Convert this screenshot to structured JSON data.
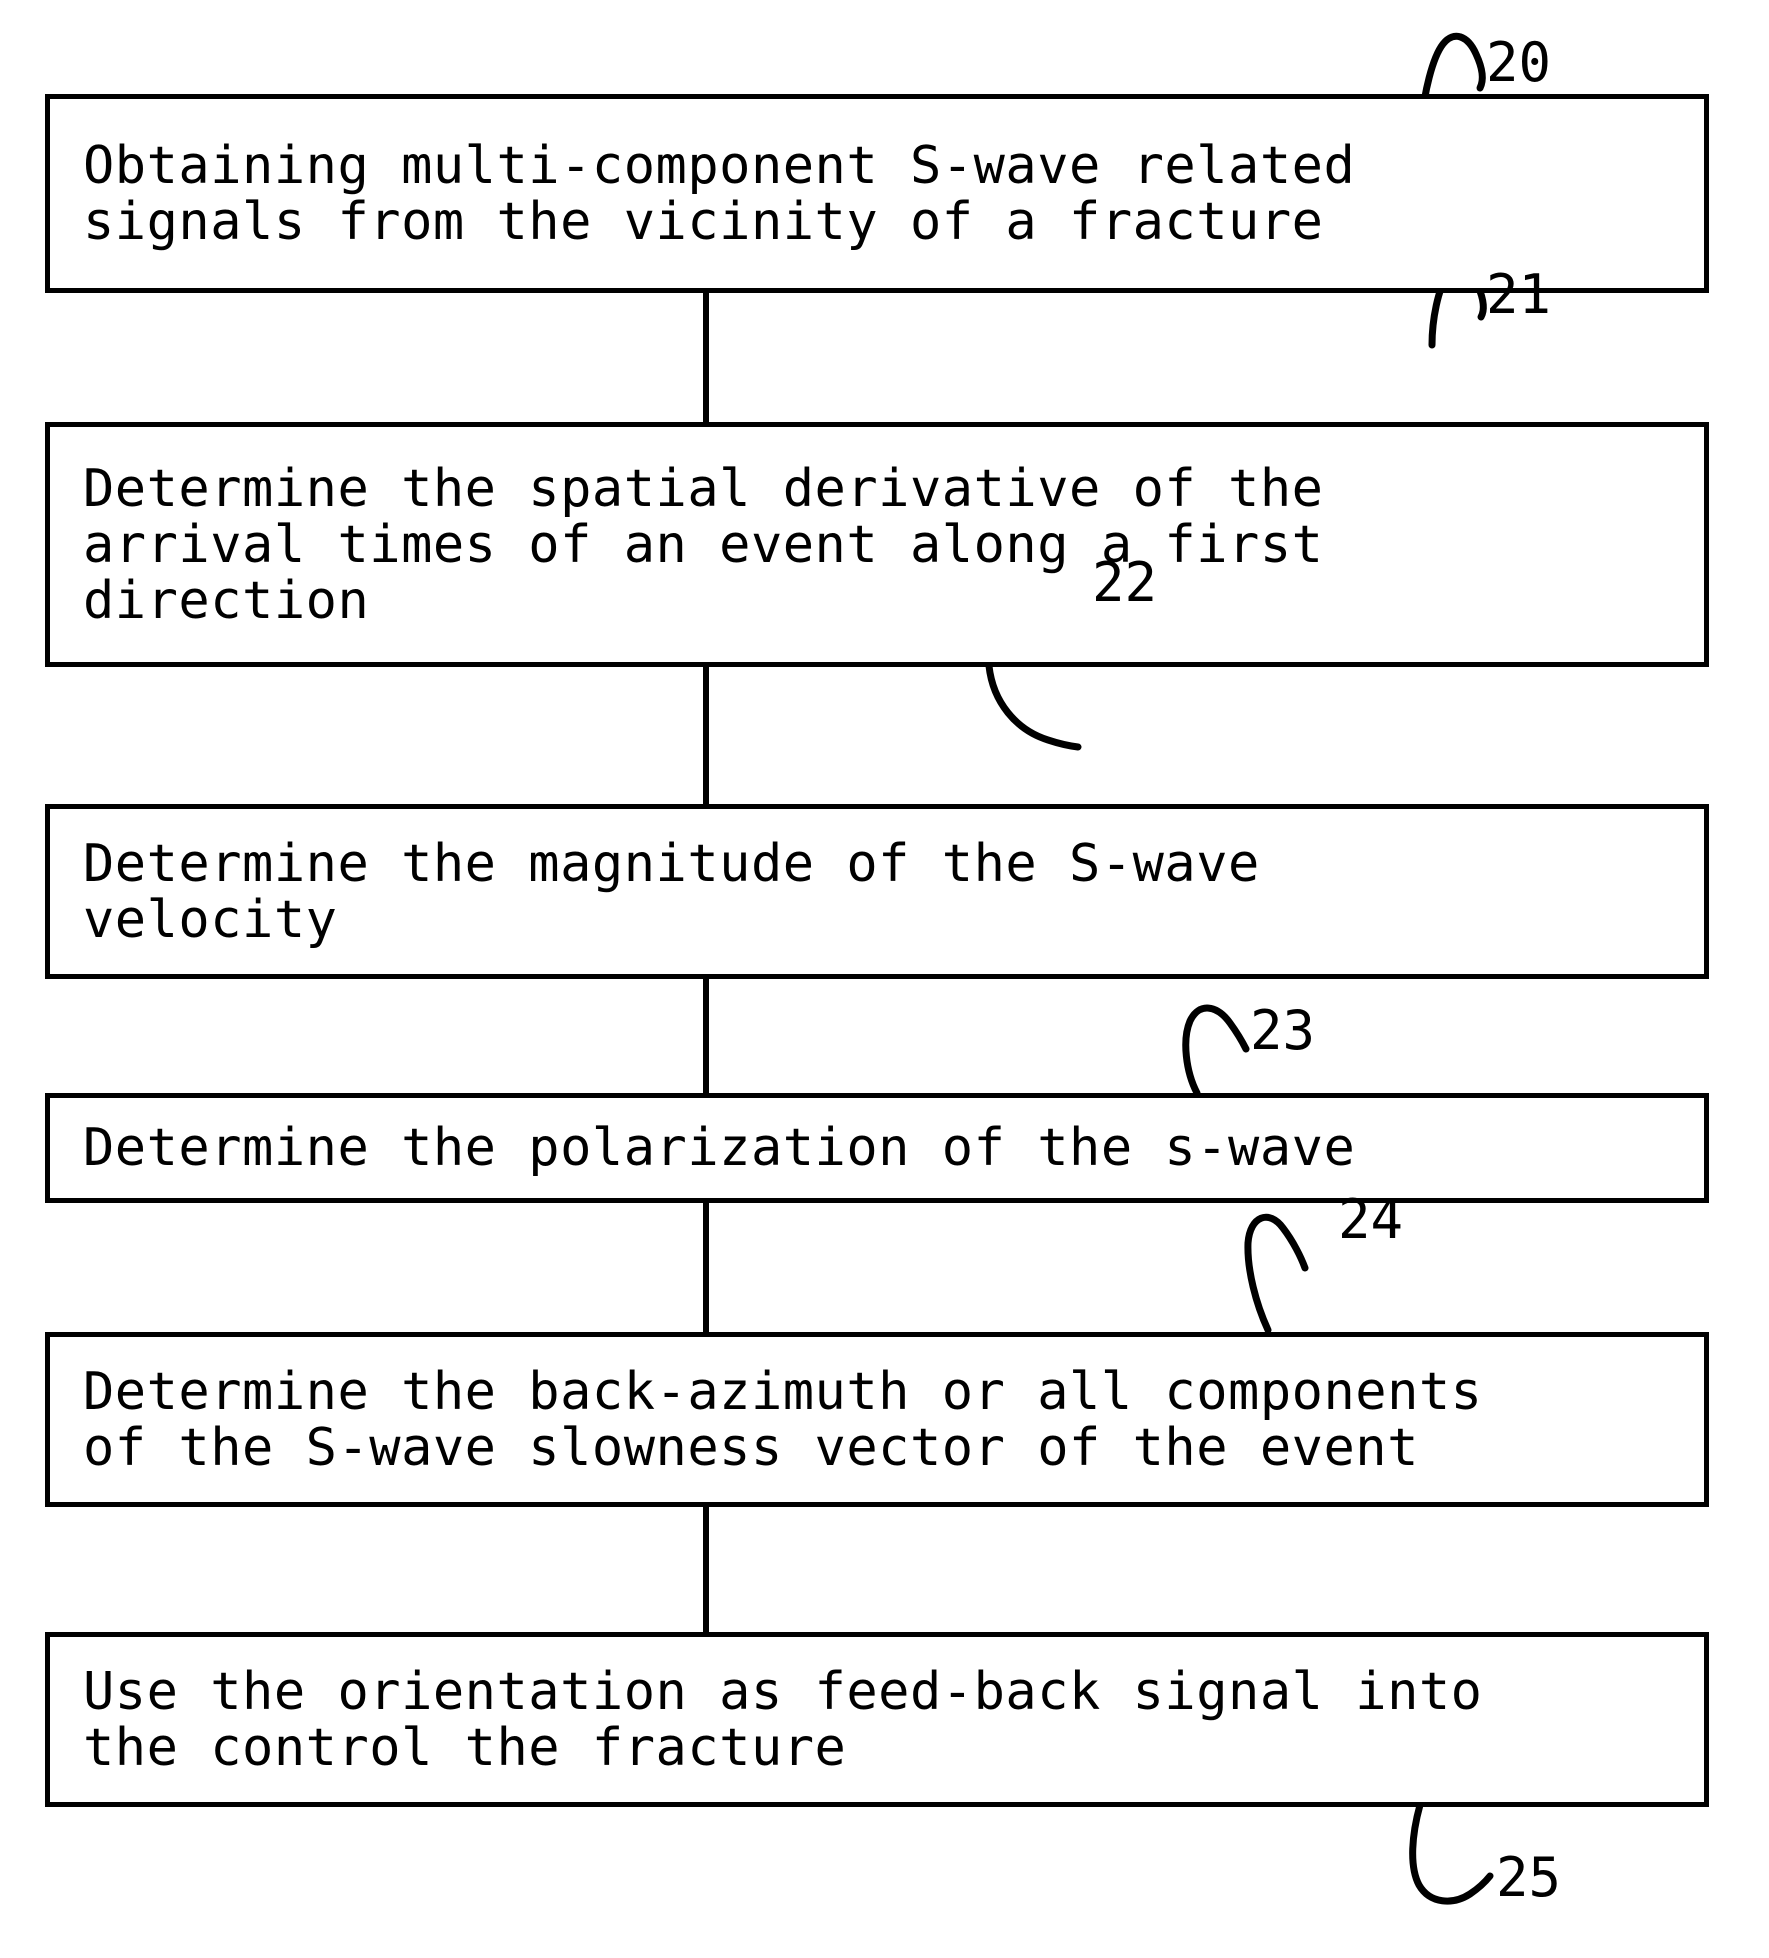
{
  "figure": {
    "type": "patent-flowchart",
    "orientation": "vertical",
    "background_color": "#ffffff",
    "line_color": "#000000"
  },
  "steps": [
    {
      "id": "step-20",
      "ref": "20",
      "lines": [
        "Obtaining multi-component S-wave related",
        "signals from the vicinity of a fracture"
      ],
      "text": "Obtaining multi-component S-wave related signals from the vicinity of a fracture"
    },
    {
      "id": "step-21",
      "ref": "21",
      "lines": [
        "Determine the spatial derivative of the",
        "arrival times of an event along a first",
        "direction"
      ],
      "text": "Determine the spatial derivative of the arrival times of an event along a first direction"
    },
    {
      "id": "step-22",
      "ref": "22",
      "lines": [
        "Determine the magnitude of the S-wave",
        "velocity"
      ],
      "text": "Determine the magnitude of the S-wave velocity"
    },
    {
      "id": "step-23",
      "ref": "23",
      "lines": [
        "Determine the polarization of the s-wave"
      ],
      "text": "Determine the polarization of the s-wave"
    },
    {
      "id": "step-24",
      "ref": "24",
      "lines": [
        "Determine the back-azimuth or all components",
        "of the S-wave slowness vector of the event"
      ],
      "text": "Determine the back-azimuth or all components of the S-wave slowness vector of the event"
    },
    {
      "id": "step-25",
      "ref": "25",
      "lines": [
        "Use the orientation as feed-back signal into",
        "the control the fracture"
      ],
      "text": "Use the orientation as feed-back signal into the control the fracture"
    }
  ],
  "reference_numerals": [
    "20",
    "21",
    "22",
    "23",
    "24",
    "25"
  ],
  "connectors": [
    {
      "from": "step-20",
      "to": "step-21"
    },
    {
      "from": "step-21",
      "to": "step-22"
    },
    {
      "from": "step-22",
      "to": "step-23"
    },
    {
      "from": "step-23",
      "to": "step-24"
    },
    {
      "from": "step-24",
      "to": "step-25"
    }
  ]
}
